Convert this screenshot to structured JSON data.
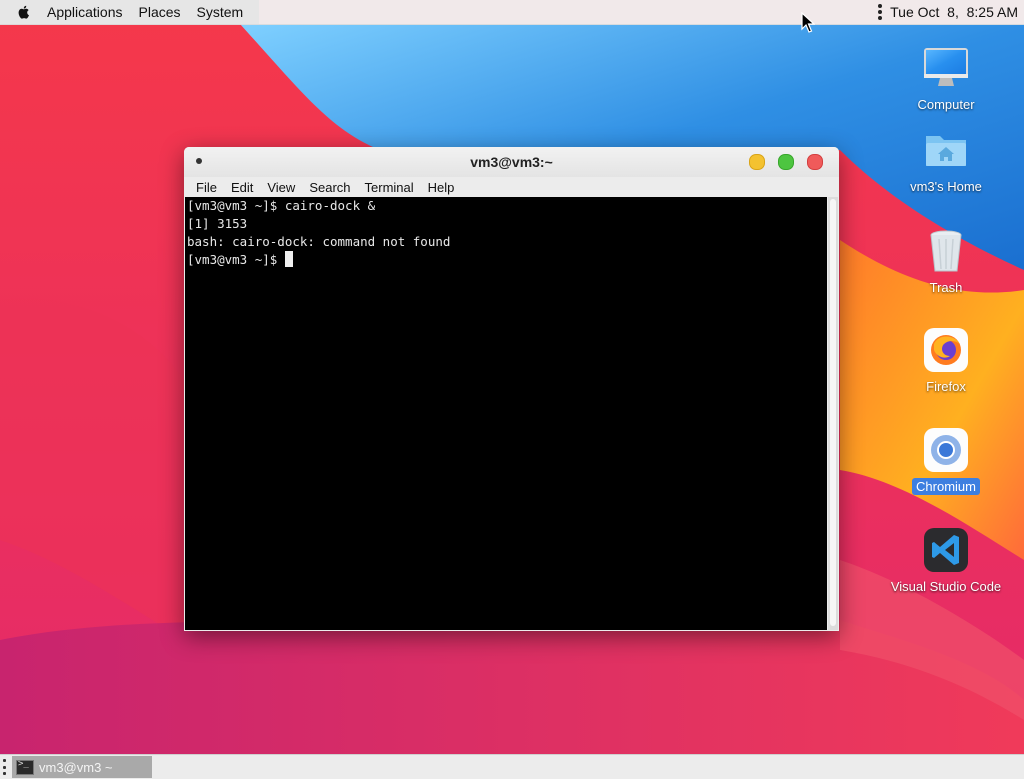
{
  "top_panel": {
    "menus": [
      {
        "label": "Applications"
      },
      {
        "label": "Places"
      },
      {
        "label": "System"
      }
    ],
    "clock": "Tue Oct  8,  8:25 AM"
  },
  "desktop_icons": [
    {
      "label": "Computer",
      "icon": "computer-icon",
      "selected": false
    },
    {
      "label": "vm3's Home",
      "icon": "home-folder-icon",
      "selected": false
    },
    {
      "label": "Trash",
      "icon": "trash-icon",
      "selected": false
    },
    {
      "label": "Firefox",
      "icon": "firefox-icon",
      "selected": false
    },
    {
      "label": "Chromium",
      "icon": "chromium-icon",
      "selected": true
    },
    {
      "label": "Visual Studio Code",
      "icon": "vscode-icon",
      "selected": false
    }
  ],
  "terminal": {
    "title": "vm3@vm3:~",
    "menus": [
      {
        "label": "File"
      },
      {
        "label": "Edit"
      },
      {
        "label": "View"
      },
      {
        "label": "Search"
      },
      {
        "label": "Terminal"
      },
      {
        "label": "Help"
      }
    ],
    "lines": [
      "[vm3@vm3 ~]$ cairo-dock &",
      "[1] 3153",
      "bash: cairo-dock: command not found",
      "[vm3@vm3 ~]$ "
    ]
  },
  "taskbar": {
    "window_button": "vm3@vm3 ~"
  },
  "colors": {
    "selection": "#3d7fe0",
    "terminal_bg": "#000000",
    "terminal_fg": "#e8e8e8"
  }
}
